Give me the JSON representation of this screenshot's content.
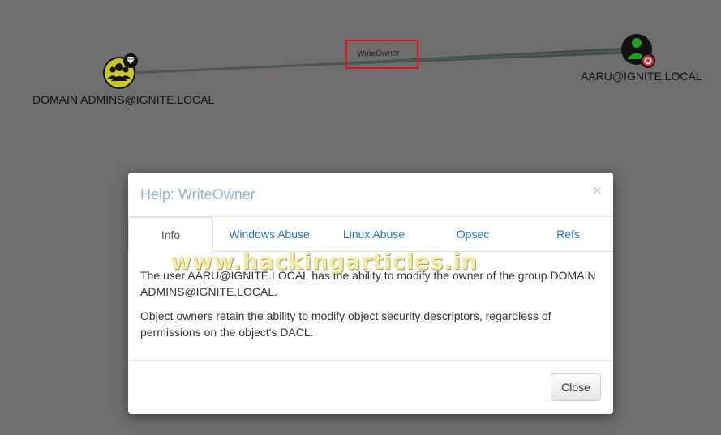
{
  "graph": {
    "source_node": {
      "label": "DOMAIN ADMINS@IGNITE.LOCAL",
      "icon": "group-icon",
      "badge": "high-value-icon"
    },
    "target_node": {
      "label": "AARU@IGNITE.LOCAL",
      "icon": "user-icon",
      "badge": "owned-target-icon"
    },
    "edge": {
      "label": "WriteOwner",
      "highlight_color": "#e0171b"
    }
  },
  "modal": {
    "title": "Help: WriteOwner",
    "close_glyph": "×",
    "tabs": [
      {
        "label": "Info",
        "active": true
      },
      {
        "label": "Windows Abuse",
        "active": false
      },
      {
        "label": "Linux Abuse",
        "active": false
      },
      {
        "label": "Opsec",
        "active": false
      },
      {
        "label": "Refs",
        "active": false
      }
    ],
    "watermark": "www.hackingarticles.in",
    "body": {
      "paragraph1": "The user AARU@IGNITE.LOCAL has the ability to modify the owner of the group DOMAIN ADMINS@IGNITE.LOCAL.",
      "paragraph2": "Object owners retain the ability to modify object security descriptors, regardless of permissions on the object's DACL."
    },
    "footer": {
      "close_label": "Close"
    }
  },
  "colors": {
    "background": "#6e6e6e",
    "group_node": "#c9c52a",
    "user_node": "#1fa11f",
    "link": "#2a76b8"
  }
}
